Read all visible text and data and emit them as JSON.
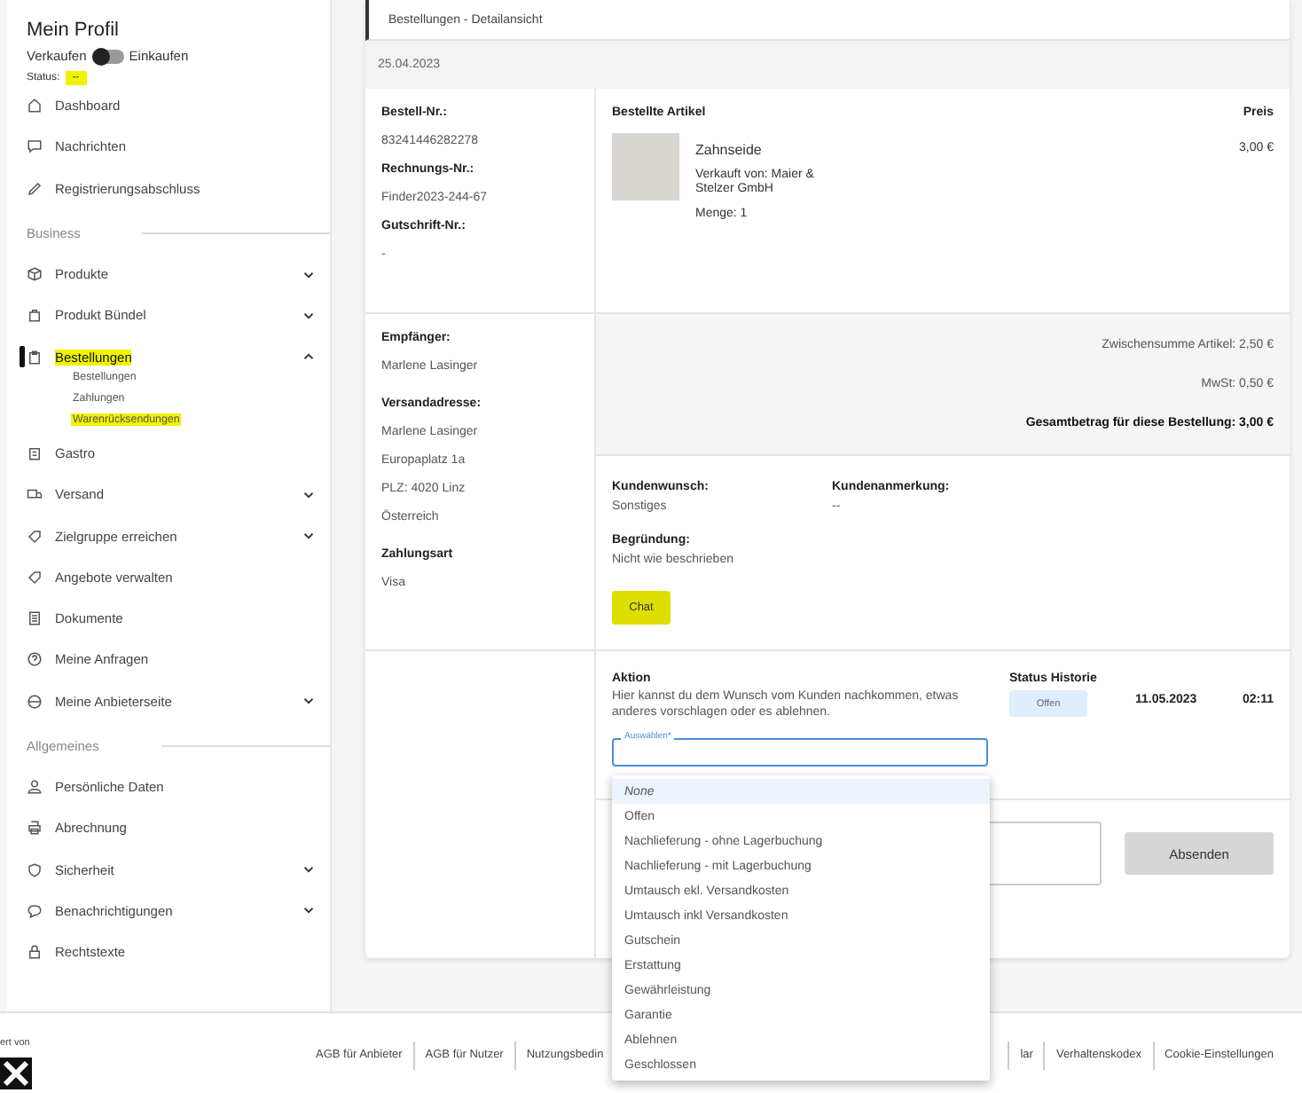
{
  "sidebar": {
    "title": "Mein Profil",
    "toggle": {
      "left_label": "Verkaufen",
      "right_label": "Einkaufen",
      "on": false
    },
    "status_label": "Status:",
    "status_value": "--",
    "status_highlighted": true,
    "items": [
      {
        "kind": "item",
        "label": "Dashboard",
        "selected": false,
        "highlighted": false
      },
      {
        "kind": "item",
        "label": "Nachrichten",
        "selected": false,
        "highlighted": false
      },
      {
        "kind": "item",
        "label": "Registrierungsabschluss",
        "selected": false,
        "highlighted": false
      },
      {
        "kind": "section",
        "label": "Business"
      },
      {
        "kind": "item",
        "label": "Produkte",
        "expanded": false,
        "selected": false,
        "highlighted": false
      },
      {
        "kind": "item",
        "label": "Produkt Bündel",
        "expanded": false,
        "selected": false,
        "highlighted": false
      },
      {
        "kind": "item",
        "label": "Bestellungen",
        "expanded": true,
        "selected": true,
        "highlighted": true,
        "children": [
          {
            "label": "Bestellungen",
            "highlighted": false
          },
          {
            "label": "Zahlungen",
            "highlighted": false
          },
          {
            "label": "Warenrücksendungen",
            "highlighted": true
          }
        ]
      },
      {
        "kind": "item",
        "label": "Gastro",
        "selected": false,
        "highlighted": false
      },
      {
        "kind": "item",
        "label": "Versand",
        "expanded": false,
        "selected": false,
        "highlighted": false
      },
      {
        "kind": "item",
        "label": "Zielgruppe erreichen",
        "expanded": false,
        "selected": false,
        "highlighted": false
      },
      {
        "kind": "item",
        "label": "Angebote verwalten",
        "selected": false,
        "highlighted": false
      },
      {
        "kind": "item",
        "label": "Dokumente",
        "selected": false,
        "highlighted": false
      },
      {
        "kind": "item",
        "label": "Meine Anfragen",
        "selected": false,
        "highlighted": false
      },
      {
        "kind": "item",
        "label": "Meine Anbieterseite",
        "expanded": false,
        "selected": false,
        "highlighted": false
      },
      {
        "kind": "section",
        "label": "Allgemeines"
      },
      {
        "kind": "item",
        "label": "Persönliche Daten",
        "selected": false,
        "highlighted": false
      },
      {
        "kind": "item",
        "label": "Abrechnung",
        "selected": false,
        "highlighted": false
      },
      {
        "kind": "item",
        "label": "Sicherheit",
        "expanded": false,
        "selected": false,
        "highlighted": false
      },
      {
        "kind": "item",
        "label": "Benachrichtigungen",
        "expanded": false,
        "selected": false,
        "highlighted": false
      },
      {
        "kind": "item",
        "label": "Rechtstexte",
        "selected": false,
        "highlighted": false
      }
    ]
  },
  "header": {
    "title": "Bestellungen - Detailansicht"
  },
  "date": "25.04.2023",
  "order_info": [
    {
      "label": "Bestell-Nr.:",
      "value": "83241446282278"
    },
    {
      "label": "Rechnungs-Nr.:",
      "value": "Finder2023-244-67"
    },
    {
      "label": "Gutschrift-Nr.:",
      "value": "-"
    }
  ],
  "items_table": {
    "heading": "Bestellte Artikel",
    "price_heading": "Preis",
    "items": [
      {
        "name": "Zahnseide",
        "seller": "Verkauft von: Maier & Stelzer GmbH",
        "quantity": "Menge: 1",
        "price": "3,00 €"
      }
    ]
  },
  "recipient": {
    "name_label": "Empfänger:",
    "name": "Marlene Lasinger",
    "address_label": "Versandadresse:",
    "address": [
      "Marlene Lasinger",
      "Europaplatz 1a",
      "PLZ: 4020 Linz",
      "Österreich"
    ],
    "payment_label": "Zahlungsart",
    "payment": "Visa"
  },
  "totals": [
    {
      "text": "Zwischensumme Artikel: 2,50 €",
      "bold": false
    },
    {
      "text": "MwSt: 0,50 €",
      "bold": false
    },
    {
      "text": "Gesamtbetrag für diese Bestellung: 3,00 €",
      "bold": true
    }
  ],
  "request": {
    "wish_label": "Kundenwunsch:",
    "wish": "Sonstiges",
    "note_label": "Kundenanmerkung:",
    "note": "--",
    "reason_label": "Begründung:",
    "reason": "Nicht wie beschrieben",
    "chat_button": "Chat"
  },
  "action": {
    "title": "Aktion",
    "description": "Hier kannst du dem Wunsch vom Kunden nachkommen, etwas anderes vorschlagen oder es ablehnen.",
    "select": {
      "label": "Auswählen*",
      "open": true,
      "options": [
        {
          "label": "None",
          "selected": true
        },
        {
          "label": "Offen",
          "selected": false
        },
        {
          "label": "Nachlieferung - ohne Lagerbuchung",
          "selected": false
        },
        {
          "label": "Nachlieferung - mit Lagerbuchung",
          "selected": false
        },
        {
          "label": "Umtausch ekl. Versandkosten",
          "selected": false
        },
        {
          "label": "Umtausch inkl Versandkosten",
          "selected": false
        },
        {
          "label": "Gutschein",
          "selected": false
        },
        {
          "label": "Erstattung",
          "selected": false
        },
        {
          "label": "Gewährleistung",
          "selected": false
        },
        {
          "label": "Garantie",
          "selected": false
        },
        {
          "label": "Ablehnen",
          "selected": false
        },
        {
          "label": "Geschlossen",
          "selected": false
        }
      ]
    },
    "send_button": "Absenden"
  },
  "status_history": {
    "title": "Status Historie",
    "entries": [
      {
        "status": "Offen",
        "date": "11.05.2023",
        "time": "02:11"
      }
    ]
  },
  "footer": {
    "credit": "ert von",
    "links": [
      "AGB für Anbieter",
      "AGB für Nutzer",
      "Nutzungsbedin",
      "lar",
      "Verhaltenskodex",
      "Cookie-Einstellungen"
    ]
  }
}
